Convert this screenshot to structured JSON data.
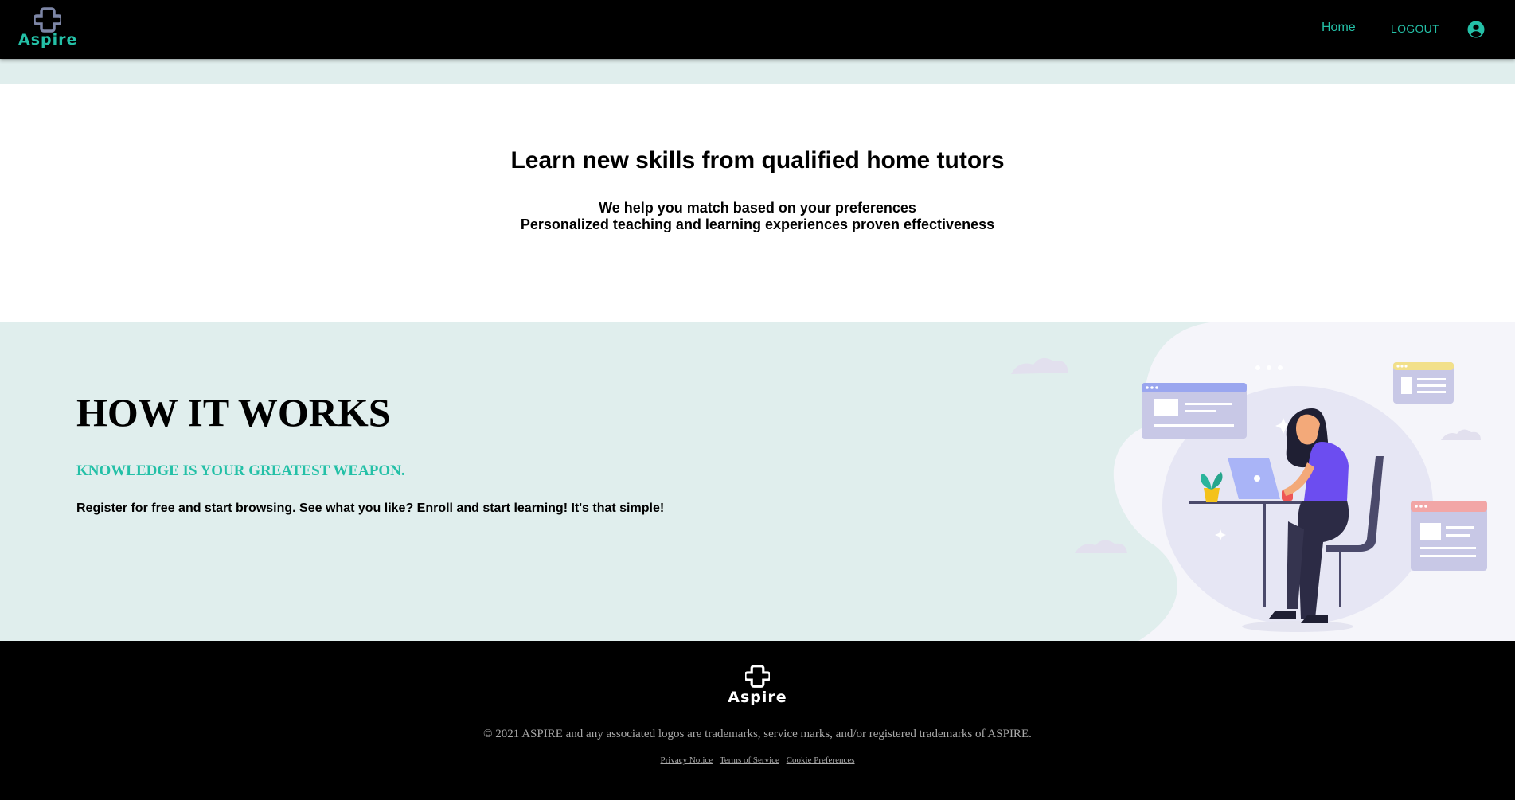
{
  "nav": {
    "logo_text": "Aspire",
    "home_label": "Home",
    "logout_label": "LOGOUT",
    "user_icon": "user-circle-icon"
  },
  "hero": {
    "title": "Learn new skills from qualified home tutors",
    "subtitle_line1": "We help you match based on your preferences",
    "subtitle_line2": "Personalized teaching and learning experiences proven effectiveness"
  },
  "how_it_works": {
    "title": "HOW IT WORKS",
    "tagline": "KNOWLEDGE IS YOUR GREATEST WEAPON.",
    "description": "Register for free and start browsing. See what you like? Enroll and start learning! It's that simple!",
    "illustration": "woman-working-on-laptop-illustration"
  },
  "footer": {
    "logo_text": "Aspire",
    "copyright": "© 2021 ASPIRE and any associated logos are trademarks, service marks, and/or registered trademarks of ASPIRE.",
    "links": [
      "Privacy Notice",
      "Terms of Service",
      "Cookie Preferences"
    ]
  },
  "colors": {
    "accent": "#24c0a7",
    "navbar_bg": "#000000",
    "section_bg": "#e0eeed",
    "footer_text": "#a9a9a9"
  }
}
